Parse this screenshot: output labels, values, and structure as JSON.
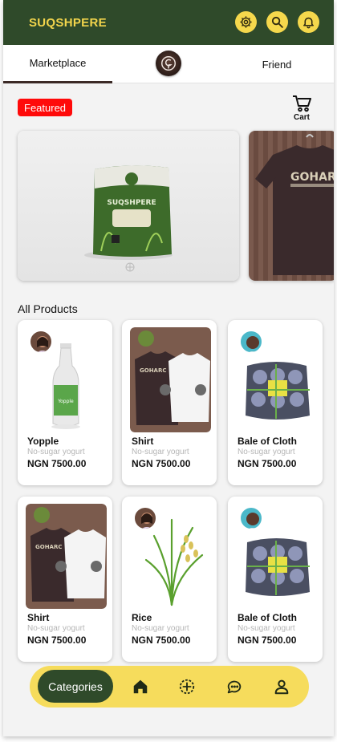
{
  "app": {
    "title": "SUQSHPERE",
    "colors": {
      "header": "#2f4a2a",
      "accent": "#f5d84c",
      "badge": "#ff0a0a"
    }
  },
  "header": {
    "icons": [
      "gear-icon",
      "search-icon",
      "bell-icon"
    ]
  },
  "tabs": {
    "marketplace": "Marketplace",
    "friend": "Friend",
    "active": "Marketplace"
  },
  "featured": {
    "badge": "Featured",
    "cart_label": "Cart",
    "items": [
      "rice-bag",
      "goharc-shirt"
    ],
    "rice_bag_text": "SUQSHPERE",
    "shirt_text": "GOHARC"
  },
  "products": {
    "section_title": "All Products",
    "items": [
      {
        "name": "Yopple",
        "desc": "No-sugar yogurt",
        "price": "NGN 7500.00"
      },
      {
        "name": "Shirt",
        "desc": "No-sugar yogurt",
        "price": "NGN 7500.00"
      },
      {
        "name": "Bale of Cloth",
        "desc": "No-sugar yogurt",
        "price": "NGN 7500.00"
      },
      {
        "name": "Shirt",
        "desc": "No-sugar yogurt",
        "price": "NGN 7500.00"
      },
      {
        "name": "Rice",
        "desc": "No-sugar yogurt",
        "price": "NGN 7500.00"
      },
      {
        "name": "Bale of Cloth",
        "desc": "No-sugar yogurt",
        "price": "NGN 7500.00"
      }
    ]
  },
  "bottom_nav": {
    "categories": "Categories",
    "icons": [
      "home-icon",
      "add-icon",
      "chat-icon",
      "profile-icon"
    ]
  }
}
